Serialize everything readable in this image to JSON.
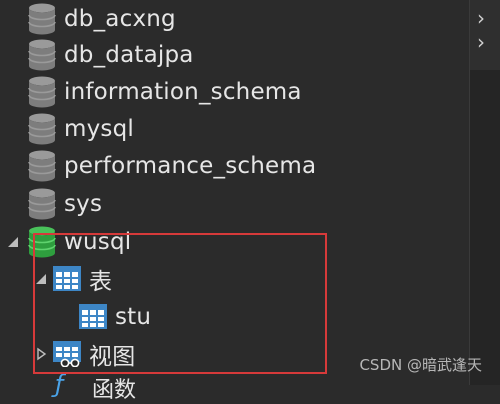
{
  "databases": [
    {
      "label": "db_acxng",
      "active": false
    },
    {
      "label": "db_datajpa",
      "active": false
    },
    {
      "label": "information_schema",
      "active": false
    },
    {
      "label": "mysql",
      "active": false
    },
    {
      "label": "performance_schema",
      "active": false
    },
    {
      "label": "sys",
      "active": false
    },
    {
      "label": "wusql",
      "active": true
    }
  ],
  "wusql_children": {
    "tables_label": "表",
    "table_item": "stu",
    "views_label": "视图",
    "functions_label": "函数"
  },
  "watermark": "CSDN @暗武逢天",
  "colors": {
    "inactive_db": "#8a8a8a",
    "active_db": "#2e9e3e",
    "table_blue": "#3d86c6",
    "highlight_red": "#d63a3a"
  }
}
